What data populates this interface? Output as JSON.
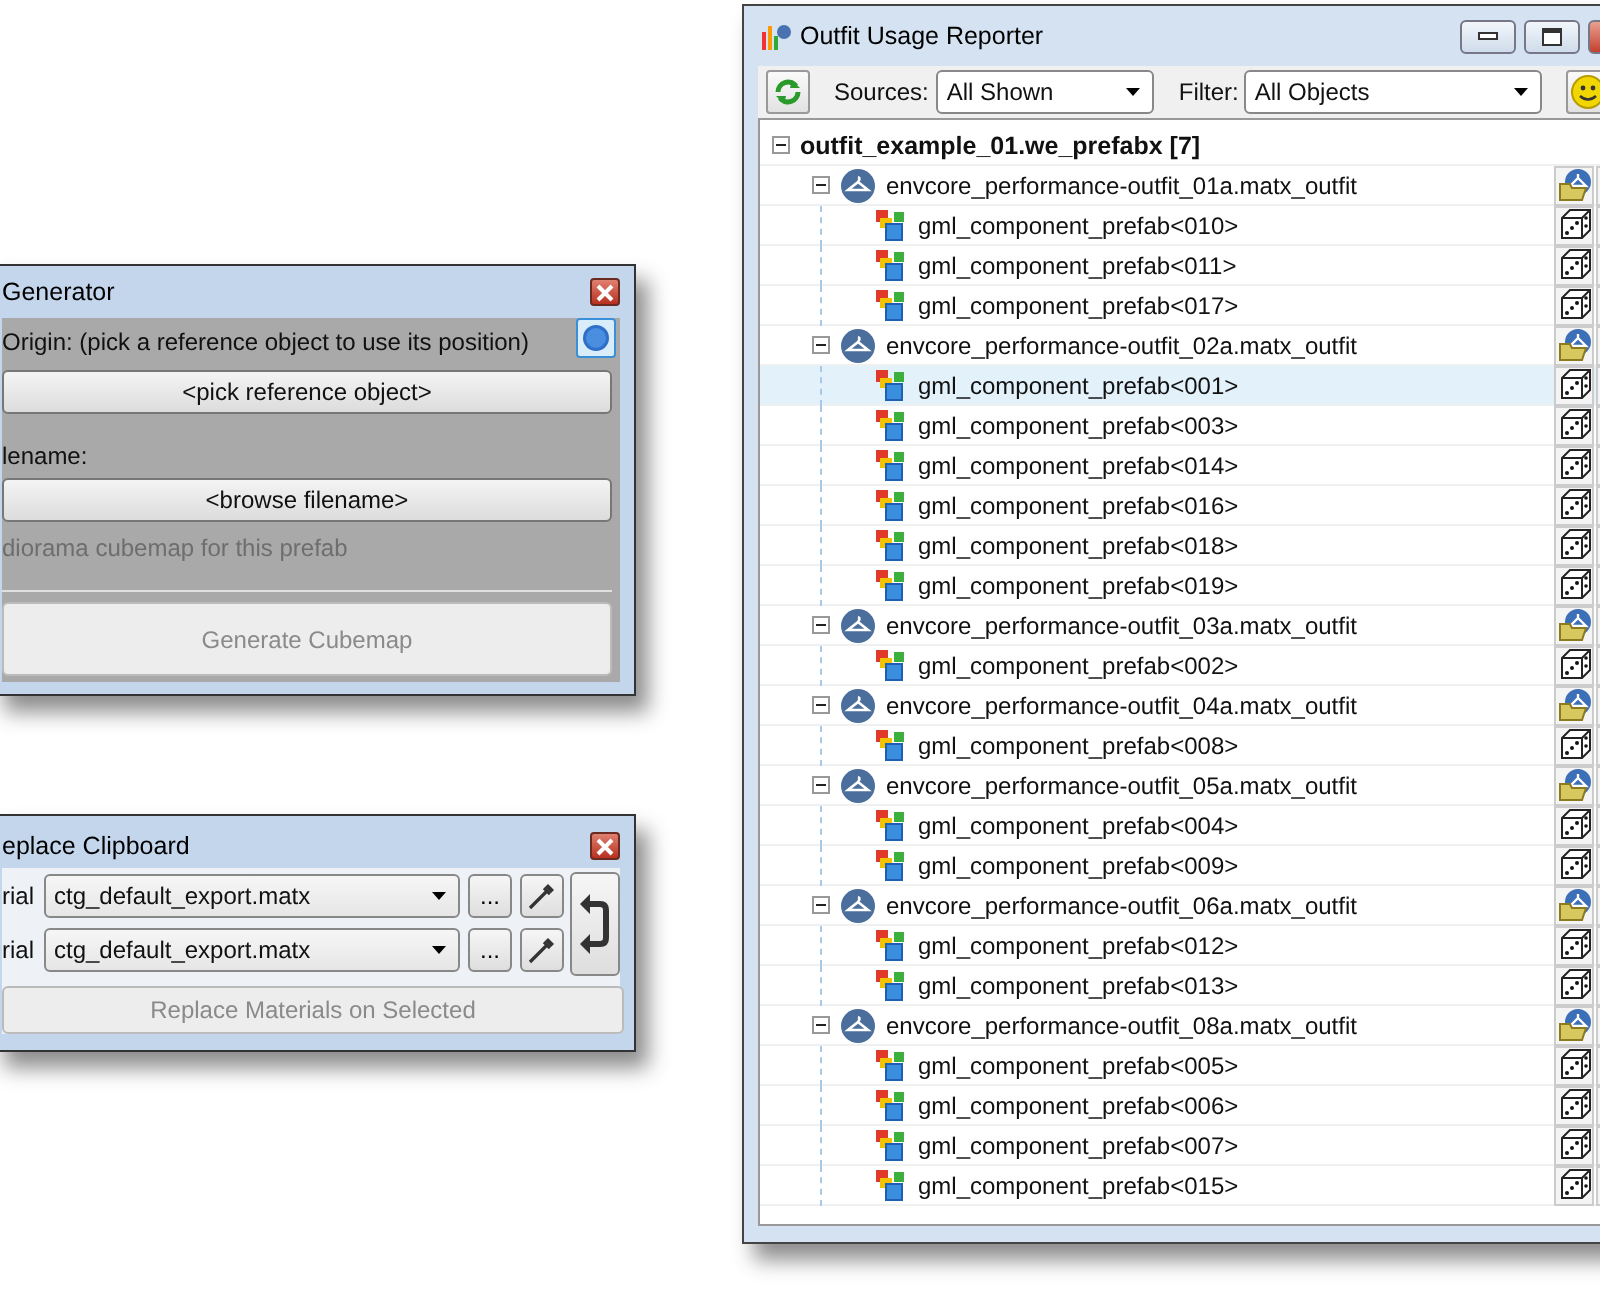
{
  "generator_window": {
    "title": "Generator",
    "origin_label": "Origin:  (pick a reference object to use its position)",
    "pick_button": "<pick reference object>",
    "filename_label": "lename:",
    "browse_button": "<browse filename>",
    "cubemap_option": {
      "label": "diorama cubemap for this prefab",
      "disabled": true
    },
    "generate_button": {
      "label": "Generate Cubemap",
      "disabled": true
    }
  },
  "clipboard_window": {
    "title": "eplace Clipboard",
    "rows": [
      {
        "label": "rial",
        "value": "ctg_default_export.matx",
        "browse": "..."
      },
      {
        "label": "rial",
        "value": "ctg_default_export.matx",
        "browse": "..."
      }
    ],
    "replace_button": {
      "label": "Replace Materials on Selected",
      "disabled": true
    }
  },
  "reporter_window": {
    "title": "Outfit Usage Reporter",
    "sources": {
      "label": "Sources:",
      "value": "All Shown"
    },
    "filter": {
      "label": "Filter:",
      "value": "All Objects"
    },
    "tree": {
      "label": "outfit_example_01.we_prefabx [7]",
      "expanded": true,
      "children": [
        {
          "label": "envcore_performance-outfit_01a.matx_outfit",
          "expanded": true,
          "selected": false,
          "children": [
            {
              "label": "gml_component_prefab<010>",
              "selected": false
            },
            {
              "label": "gml_component_prefab<011>",
              "selected": false
            },
            {
              "label": "gml_component_prefab<017>",
              "selected": false
            }
          ]
        },
        {
          "label": "envcore_performance-outfit_02a.matx_outfit",
          "expanded": true,
          "selected": false,
          "children": [
            {
              "label": "gml_component_prefab<001>",
              "selected": true
            },
            {
              "label": "gml_component_prefab<003>",
              "selected": false
            },
            {
              "label": "gml_component_prefab<014>",
              "selected": false
            },
            {
              "label": "gml_component_prefab<016>",
              "selected": false
            },
            {
              "label": "gml_component_prefab<018>",
              "selected": false
            },
            {
              "label": "gml_component_prefab<019>",
              "selected": false
            }
          ]
        },
        {
          "label": "envcore_performance-outfit_03a.matx_outfit",
          "expanded": true,
          "selected": false,
          "children": [
            {
              "label": "gml_component_prefab<002>",
              "selected": false
            }
          ]
        },
        {
          "label": "envcore_performance-outfit_04a.matx_outfit",
          "expanded": true,
          "selected": false,
          "children": [
            {
              "label": "gml_component_prefab<008>",
              "selected": false
            }
          ]
        },
        {
          "label": "envcore_performance-outfit_05a.matx_outfit",
          "expanded": true,
          "selected": false,
          "children": [
            {
              "label": "gml_component_prefab<004>",
              "selected": false
            },
            {
              "label": "gml_component_prefab<009>",
              "selected": false
            }
          ]
        },
        {
          "label": "envcore_performance-outfit_06a.matx_outfit",
          "expanded": true,
          "selected": false,
          "children": [
            {
              "label": "gml_component_prefab<012>",
              "selected": false
            },
            {
              "label": "gml_component_prefab<013>",
              "selected": false
            }
          ]
        },
        {
          "label": "envcore_performance-outfit_08a.matx_outfit",
          "expanded": true,
          "selected": false,
          "children": [
            {
              "label": "gml_component_prefab<005>",
              "selected": false
            },
            {
              "label": "gml_component_prefab<006>",
              "selected": false
            },
            {
              "label": "gml_component_prefab<007>",
              "selected": false
            },
            {
              "label": "gml_component_prefab<015>",
              "selected": false
            }
          ]
        }
      ]
    }
  }
}
